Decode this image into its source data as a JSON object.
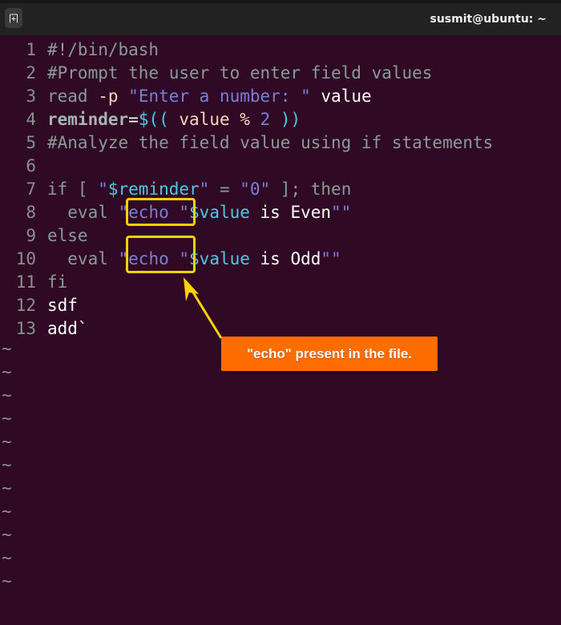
{
  "window": {
    "title": "susmit@ubuntu: ~",
    "new_tab_icon": "new-tab-icon"
  },
  "editor": {
    "lines": [
      {
        "n": "1",
        "parts": [
          {
            "t": "#!/bin/bash",
            "c": "c-comment"
          }
        ]
      },
      {
        "n": "2",
        "parts": [
          {
            "t": "#Prompt the user to enter field values",
            "c": "c-comment"
          }
        ]
      },
      {
        "n": "3",
        "parts": [
          {
            "t": "read ",
            "c": "c-kw"
          },
          {
            "t": "-p",
            "c": "c-op"
          },
          {
            "t": " ",
            "c": "c-plain"
          },
          {
            "t": "\"Enter a number: \"",
            "c": "c-str"
          },
          {
            "t": " value",
            "c": "c-plain"
          }
        ]
      },
      {
        "n": "4",
        "parts": [
          {
            "t": "reminder",
            "c": "c-bold"
          },
          {
            "t": "=",
            "c": "c-plain"
          },
          {
            "t": "$((",
            "c": "c-var"
          },
          {
            "t": " value % ",
            "c": "c-op"
          },
          {
            "t": "2",
            "c": "c-str"
          },
          {
            "t": " ))",
            "c": "c-var"
          }
        ]
      },
      {
        "n": "5",
        "parts": [
          {
            "t": "#Analyze the field value using if statements",
            "c": "c-comment"
          }
        ]
      },
      {
        "n": "6",
        "parts": []
      },
      {
        "n": "7",
        "parts": [
          {
            "t": "if [ ",
            "c": "c-kw"
          },
          {
            "t": "\"",
            "c": "c-str"
          },
          {
            "t": "$reminder",
            "c": "c-var"
          },
          {
            "t": "\"",
            "c": "c-str"
          },
          {
            "t": " = ",
            "c": "c-kw"
          },
          {
            "t": "\"0\"",
            "c": "c-str"
          },
          {
            "t": " ]; then",
            "c": "c-kw"
          }
        ]
      },
      {
        "n": "8",
        "parts": [
          {
            "t": "  eval ",
            "c": "c-kw"
          },
          {
            "t": "\"echo ",
            "c": "c-str"
          },
          {
            "t": "\"",
            "c": "c-str"
          },
          {
            "t": "$value",
            "c": "c-var"
          },
          {
            "t": " is Even",
            "c": "c-plain"
          },
          {
            "t": "\"\"",
            "c": "c-str"
          }
        ]
      },
      {
        "n": "9",
        "parts": [
          {
            "t": "else",
            "c": "c-kw"
          }
        ]
      },
      {
        "n": "10",
        "parts": [
          {
            "t": "  eval ",
            "c": "c-kw"
          },
          {
            "t": "\"echo ",
            "c": "c-str"
          },
          {
            "t": "\"",
            "c": "c-str"
          },
          {
            "t": "$value",
            "c": "c-var"
          },
          {
            "t": " is Odd",
            "c": "c-plain"
          },
          {
            "t": "\"\"",
            "c": "c-str"
          }
        ]
      },
      {
        "n": "11",
        "parts": [
          {
            "t": "fi",
            "c": "c-kw"
          }
        ]
      },
      {
        "n": "12",
        "parts": [
          {
            "t": "sdf",
            "c": "c-plain"
          }
        ]
      },
      {
        "n": "13",
        "parts": [
          {
            "t": "add`",
            "c": "c-plain"
          }
        ]
      }
    ],
    "empty_line_marker": "~",
    "empty_line_count": 11
  },
  "annotation": {
    "callout_text": "\"echo\" present in the file.",
    "highlight_color": "#ffd200",
    "callout_color": "#ff6d00"
  }
}
